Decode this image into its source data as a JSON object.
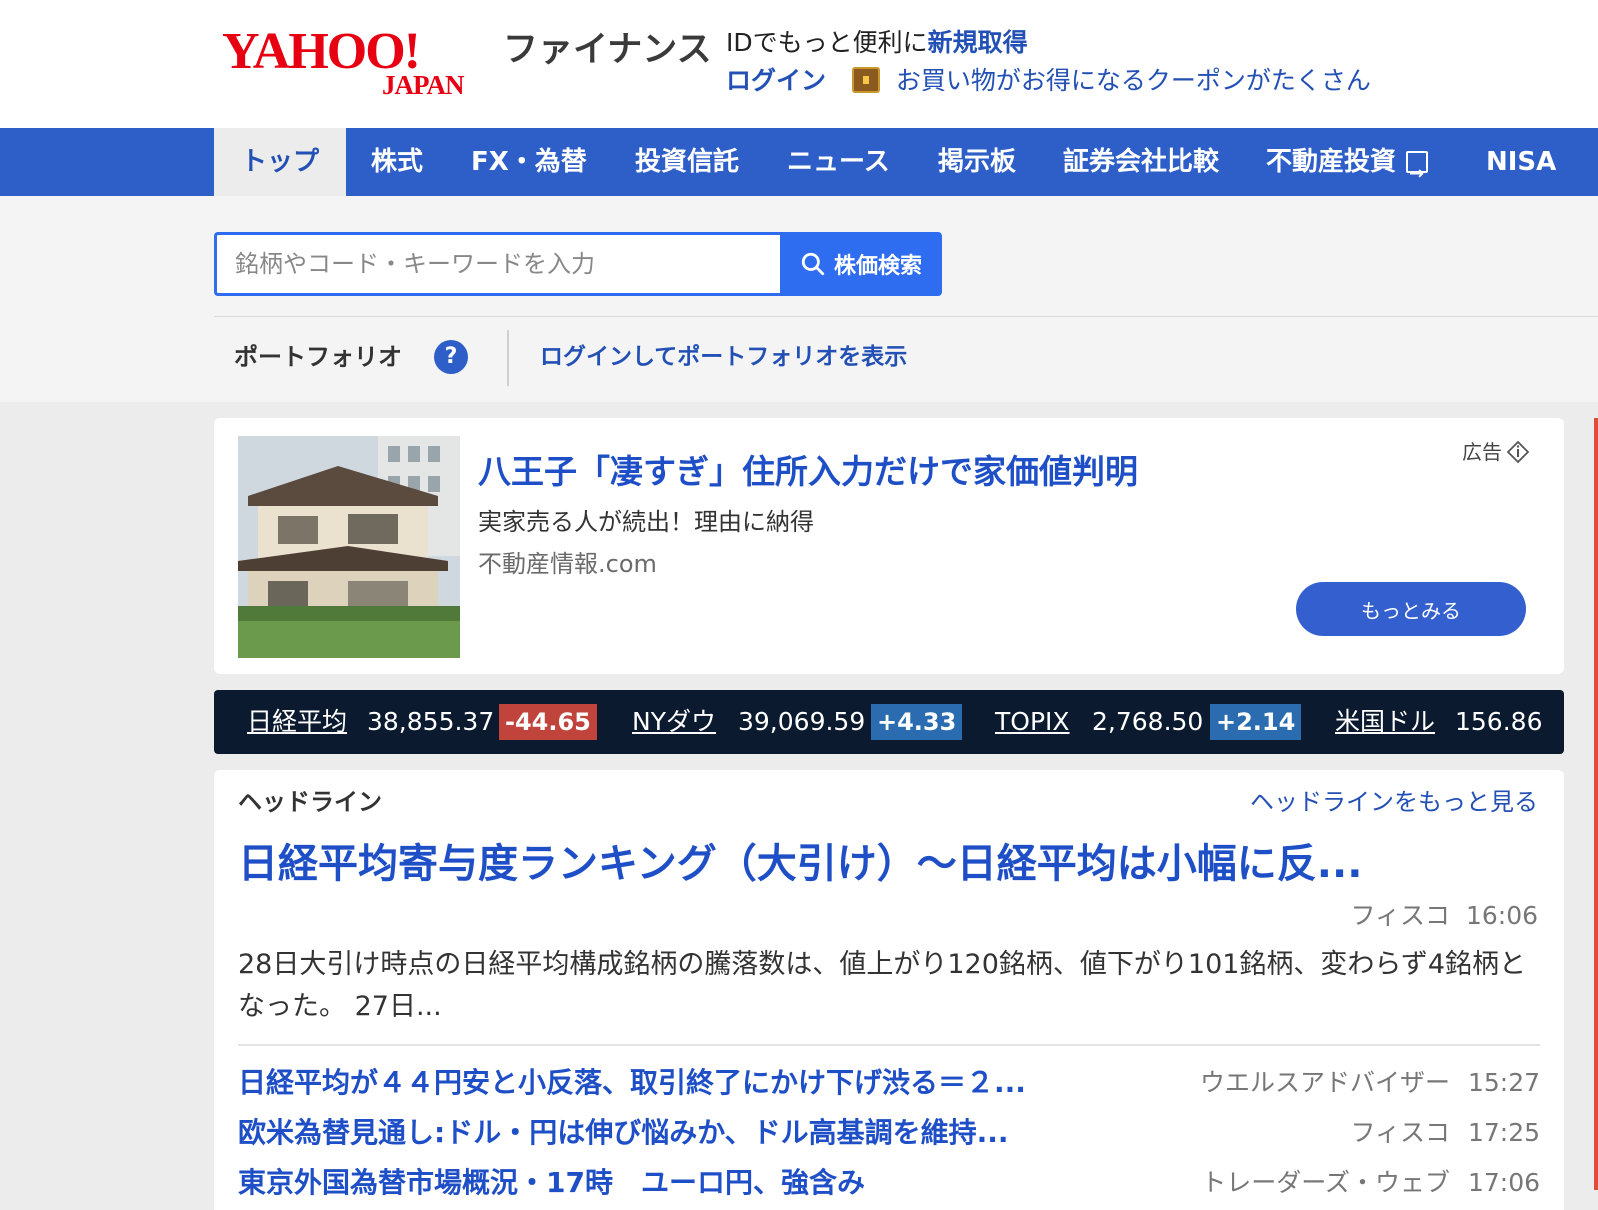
{
  "header": {
    "logo_main": "YAHOO!",
    "logo_sub": "JAPAN",
    "service_name": "ファイナンス",
    "promo_text": "IDでもっと便利に",
    "register_link": "新規取得",
    "login_link": "ログイン",
    "coupon_text": "お買い物がお得になるクーポンがたくさん",
    "coupon_icon": "treasure-chest-icon"
  },
  "nav": {
    "items": [
      {
        "label": "トップ",
        "active": true
      },
      {
        "label": "株式"
      },
      {
        "label": "FX・為替"
      },
      {
        "label": "投資信託"
      },
      {
        "label": "ニュース"
      },
      {
        "label": "掲示板"
      },
      {
        "label": "証券会社比較"
      },
      {
        "label": "不動産投資",
        "icon": "external-link-icon"
      },
      {
        "label": "NISA"
      }
    ],
    "active_color": "#2250b4",
    "bar_color": "#2e5fc8"
  },
  "search": {
    "placeholder": "銘柄やコード・キーワードを入力",
    "value": "",
    "button_label": "株価検索",
    "button_icon": "search-icon"
  },
  "portfolio": {
    "label": "ポートフォリオ",
    "help": "?",
    "login_text": "ログインしてポートフォリオを表示"
  },
  "ad": {
    "title": "八王子「凄すぎ」住所入力だけで家価値判明",
    "description": "実家売る人が続出！理由に納得",
    "source": "不動産情報.com",
    "label": "広告",
    "button_label": "もっとみる"
  },
  "ticker": {
    "items": [
      {
        "name": "日経平均",
        "value": "38,855.37",
        "change": "-44.65",
        "direction": "down"
      },
      {
        "name": "NYダウ",
        "value": "39,069.59",
        "change": "+4.33",
        "direction": "up"
      },
      {
        "name": "TOPIX",
        "value": "2,768.50",
        "change": "+2.14",
        "direction": "up"
      },
      {
        "name": "米国ドル",
        "value": "156.86"
      }
    ],
    "down_color": "#c0443c",
    "up_color": "#2b6cb0"
  },
  "headlines": {
    "section_title": "ヘッドライン",
    "more_link": "ヘッドラインをもっと見る",
    "main": {
      "title": "日経平均寄与度ランキング（大引け）～日経平均は小幅に反...",
      "source": "フィスコ",
      "time": "16:06",
      "description": "28日大引け時点の日経平均構成銘柄の騰落数は、値上がり120銘柄、値下がり101銘柄、変わらず4銘柄となった。 27日..."
    },
    "items": [
      {
        "title": "日経平均が４４円安と小反落、取引終了にかけ下げ渋る＝２...",
        "source": "ウエルスアドバイザー",
        "time": "15:27"
      },
      {
        "title": "欧米為替見通し:ドル・円は伸び悩みか、ドル高基調を維持...",
        "source": "フィスコ",
        "time": "17:25"
      },
      {
        "title": "東京外国為替市場概況・17時　ユーロ円、強含み",
        "source": "トレーダーズ・ウェブ",
        "time": "17:06"
      }
    ]
  }
}
